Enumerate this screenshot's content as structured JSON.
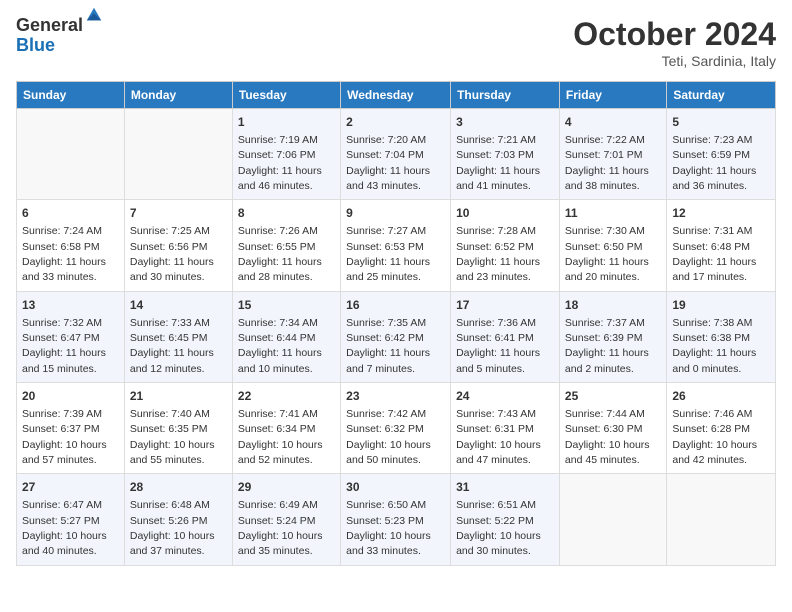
{
  "logo": {
    "general": "General",
    "blue": "Blue"
  },
  "title": "October 2024",
  "location": "Teti, Sardinia, Italy",
  "header_days": [
    "Sunday",
    "Monday",
    "Tuesday",
    "Wednesday",
    "Thursday",
    "Friday",
    "Saturday"
  ],
  "weeks": [
    [
      {
        "day": "",
        "info": ""
      },
      {
        "day": "",
        "info": ""
      },
      {
        "day": "1",
        "info": "Sunrise: 7:19 AM\nSunset: 7:06 PM\nDaylight: 11 hours and 46 minutes."
      },
      {
        "day": "2",
        "info": "Sunrise: 7:20 AM\nSunset: 7:04 PM\nDaylight: 11 hours and 43 minutes."
      },
      {
        "day": "3",
        "info": "Sunrise: 7:21 AM\nSunset: 7:03 PM\nDaylight: 11 hours and 41 minutes."
      },
      {
        "day": "4",
        "info": "Sunrise: 7:22 AM\nSunset: 7:01 PM\nDaylight: 11 hours and 38 minutes."
      },
      {
        "day": "5",
        "info": "Sunrise: 7:23 AM\nSunset: 6:59 PM\nDaylight: 11 hours and 36 minutes."
      }
    ],
    [
      {
        "day": "6",
        "info": "Sunrise: 7:24 AM\nSunset: 6:58 PM\nDaylight: 11 hours and 33 minutes."
      },
      {
        "day": "7",
        "info": "Sunrise: 7:25 AM\nSunset: 6:56 PM\nDaylight: 11 hours and 30 minutes."
      },
      {
        "day": "8",
        "info": "Sunrise: 7:26 AM\nSunset: 6:55 PM\nDaylight: 11 hours and 28 minutes."
      },
      {
        "day": "9",
        "info": "Sunrise: 7:27 AM\nSunset: 6:53 PM\nDaylight: 11 hours and 25 minutes."
      },
      {
        "day": "10",
        "info": "Sunrise: 7:28 AM\nSunset: 6:52 PM\nDaylight: 11 hours and 23 minutes."
      },
      {
        "day": "11",
        "info": "Sunrise: 7:30 AM\nSunset: 6:50 PM\nDaylight: 11 hours and 20 minutes."
      },
      {
        "day": "12",
        "info": "Sunrise: 7:31 AM\nSunset: 6:48 PM\nDaylight: 11 hours and 17 minutes."
      }
    ],
    [
      {
        "day": "13",
        "info": "Sunrise: 7:32 AM\nSunset: 6:47 PM\nDaylight: 11 hours and 15 minutes."
      },
      {
        "day": "14",
        "info": "Sunrise: 7:33 AM\nSunset: 6:45 PM\nDaylight: 11 hours and 12 minutes."
      },
      {
        "day": "15",
        "info": "Sunrise: 7:34 AM\nSunset: 6:44 PM\nDaylight: 11 hours and 10 minutes."
      },
      {
        "day": "16",
        "info": "Sunrise: 7:35 AM\nSunset: 6:42 PM\nDaylight: 11 hours and 7 minutes."
      },
      {
        "day": "17",
        "info": "Sunrise: 7:36 AM\nSunset: 6:41 PM\nDaylight: 11 hours and 5 minutes."
      },
      {
        "day": "18",
        "info": "Sunrise: 7:37 AM\nSunset: 6:39 PM\nDaylight: 11 hours and 2 minutes."
      },
      {
        "day": "19",
        "info": "Sunrise: 7:38 AM\nSunset: 6:38 PM\nDaylight: 11 hours and 0 minutes."
      }
    ],
    [
      {
        "day": "20",
        "info": "Sunrise: 7:39 AM\nSunset: 6:37 PM\nDaylight: 10 hours and 57 minutes."
      },
      {
        "day": "21",
        "info": "Sunrise: 7:40 AM\nSunset: 6:35 PM\nDaylight: 10 hours and 55 minutes."
      },
      {
        "day": "22",
        "info": "Sunrise: 7:41 AM\nSunset: 6:34 PM\nDaylight: 10 hours and 52 minutes."
      },
      {
        "day": "23",
        "info": "Sunrise: 7:42 AM\nSunset: 6:32 PM\nDaylight: 10 hours and 50 minutes."
      },
      {
        "day": "24",
        "info": "Sunrise: 7:43 AM\nSunset: 6:31 PM\nDaylight: 10 hours and 47 minutes."
      },
      {
        "day": "25",
        "info": "Sunrise: 7:44 AM\nSunset: 6:30 PM\nDaylight: 10 hours and 45 minutes."
      },
      {
        "day": "26",
        "info": "Sunrise: 7:46 AM\nSunset: 6:28 PM\nDaylight: 10 hours and 42 minutes."
      }
    ],
    [
      {
        "day": "27",
        "info": "Sunrise: 6:47 AM\nSunset: 5:27 PM\nDaylight: 10 hours and 40 minutes."
      },
      {
        "day": "28",
        "info": "Sunrise: 6:48 AM\nSunset: 5:26 PM\nDaylight: 10 hours and 37 minutes."
      },
      {
        "day": "29",
        "info": "Sunrise: 6:49 AM\nSunset: 5:24 PM\nDaylight: 10 hours and 35 minutes."
      },
      {
        "day": "30",
        "info": "Sunrise: 6:50 AM\nSunset: 5:23 PM\nDaylight: 10 hours and 33 minutes."
      },
      {
        "day": "31",
        "info": "Sunrise: 6:51 AM\nSunset: 5:22 PM\nDaylight: 10 hours and 30 minutes."
      },
      {
        "day": "",
        "info": ""
      },
      {
        "day": "",
        "info": ""
      }
    ]
  ]
}
